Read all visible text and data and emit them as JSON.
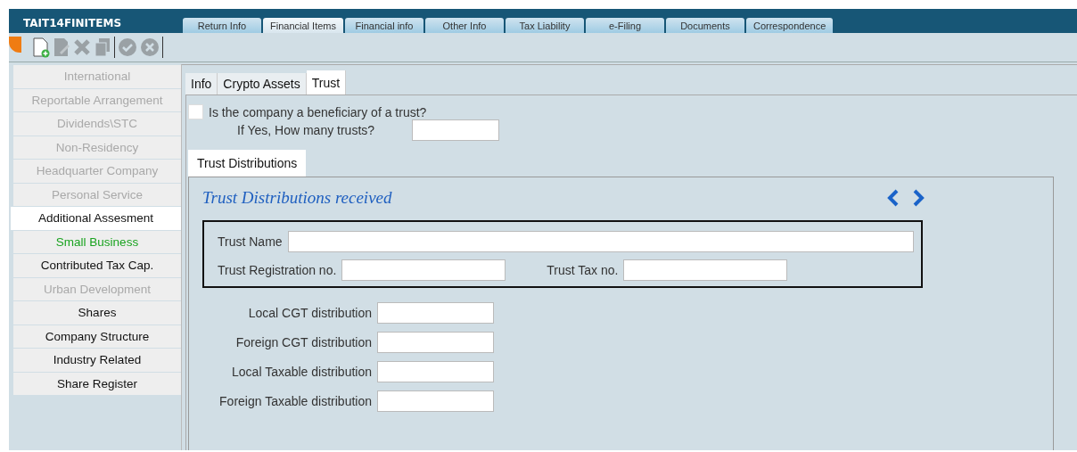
{
  "window": {
    "title": "TAIT14FINITEMS"
  },
  "tabs": [
    {
      "label": "Return Info",
      "selected": false
    },
    {
      "label": "Financial Items",
      "selected": true
    },
    {
      "label": "Financial info",
      "selected": false
    },
    {
      "label": "Other Info",
      "selected": false
    },
    {
      "label": "Tax Liability",
      "selected": false
    },
    {
      "label": "e-Filing",
      "selected": false
    },
    {
      "label": "Documents",
      "selected": false
    },
    {
      "label": "Correspondence",
      "selected": false
    }
  ],
  "toolbar": [
    {
      "kind": "new",
      "disabled": false
    },
    {
      "kind": "edit",
      "disabled": true
    },
    {
      "kind": "delete",
      "disabled": true
    },
    {
      "kind": "copy",
      "disabled": true
    },
    {
      "kind": "separator"
    },
    {
      "kind": "accept",
      "disabled": true
    },
    {
      "kind": "cancel",
      "disabled": true
    },
    {
      "kind": "separator"
    }
  ],
  "sidebar": {
    "items": [
      {
        "label": "International",
        "kind": "disabled",
        "selected": false
      },
      {
        "label": "Reportable Arrangement",
        "kind": "disabled",
        "selected": false
      },
      {
        "label": "Dividends\\STC",
        "kind": "disabled",
        "selected": false
      },
      {
        "label": "Non-Residency",
        "kind": "disabled",
        "selected": false
      },
      {
        "label": "Headquarter Company",
        "kind": "disabled",
        "selected": false
      },
      {
        "label": "Personal Service",
        "kind": "disabled",
        "selected": false
      },
      {
        "label": "Additional Assesment",
        "kind": "normal",
        "selected": true
      },
      {
        "label": "Small Business",
        "kind": "highlight",
        "selected": false
      },
      {
        "label": "Contributed Tax Cap.",
        "kind": "normal",
        "selected": false
      },
      {
        "label": "Urban Development",
        "kind": "disabled",
        "selected": false
      },
      {
        "label": "Shares",
        "kind": "normal",
        "selected": false
      },
      {
        "label": "Company Structure",
        "kind": "normal",
        "selected": false
      },
      {
        "label": "Industry Related",
        "kind": "normal",
        "selected": false
      },
      {
        "label": "Share Register",
        "kind": "normal",
        "selected": false
      }
    ]
  },
  "subtabs": [
    {
      "label": "Info",
      "selected": false
    },
    {
      "label": "Crypto Assets",
      "selected": false
    },
    {
      "label": "Trust",
      "selected": true
    }
  ],
  "beneficiary": {
    "label": "Is the company a beneficiary of a trust?",
    "checked": false
  },
  "trust_count": {
    "label": "If Yes, How many trusts?"
  },
  "section_tabs": [
    {
      "label": "Trust Distributions",
      "selected": true
    }
  ],
  "section": {
    "title": "Trust Distributions received",
    "trust_name": {
      "label": "Trust Name"
    },
    "registration": {
      "label": "Trust Registration no."
    },
    "tax_no": {
      "label": "Trust Tax no."
    },
    "distributions": [
      {
        "label": "Local CGT distribution"
      },
      {
        "label": "Foreign CGT distribution"
      },
      {
        "label": "Local Taxable distribution"
      },
      {
        "label": "Foreign Taxable distribution"
      }
    ]
  }
}
